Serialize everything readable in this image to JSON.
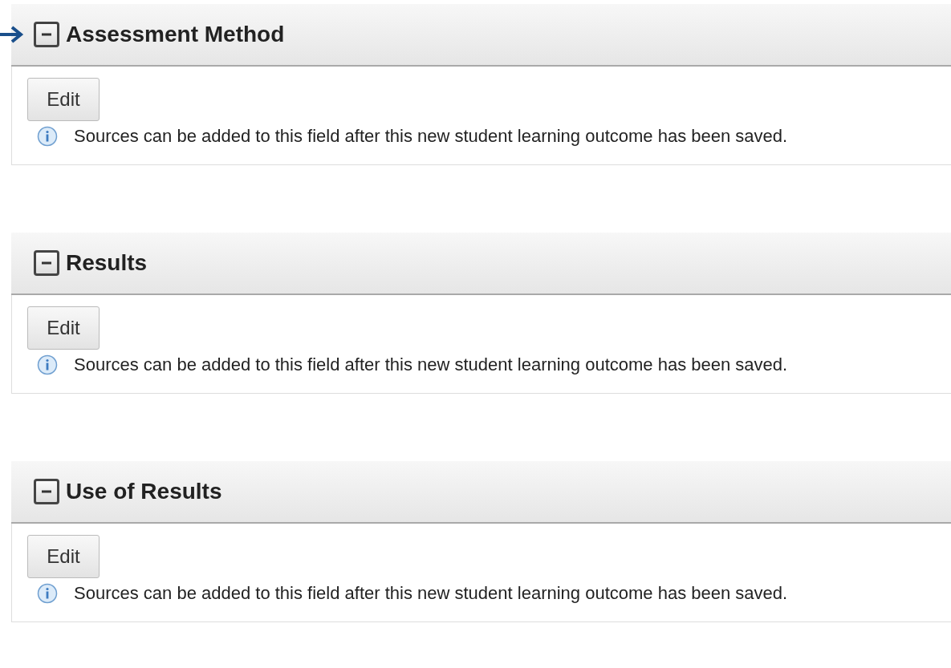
{
  "sections": [
    {
      "title": "Assessment Method",
      "expanded": true,
      "marked": true,
      "button": "Edit",
      "note": "Sources can be added to this field after this new student learning outcome has been saved."
    },
    {
      "title": "Results",
      "expanded": true,
      "marked": false,
      "button": "Edit",
      "note": "Sources can be added to this field after this new student learning outcome has been saved."
    },
    {
      "title": "Use of Results",
      "expanded": true,
      "marked": false,
      "button": "Edit",
      "note": "Sources can be added to this field after this new student learning outcome has been saved."
    }
  ]
}
